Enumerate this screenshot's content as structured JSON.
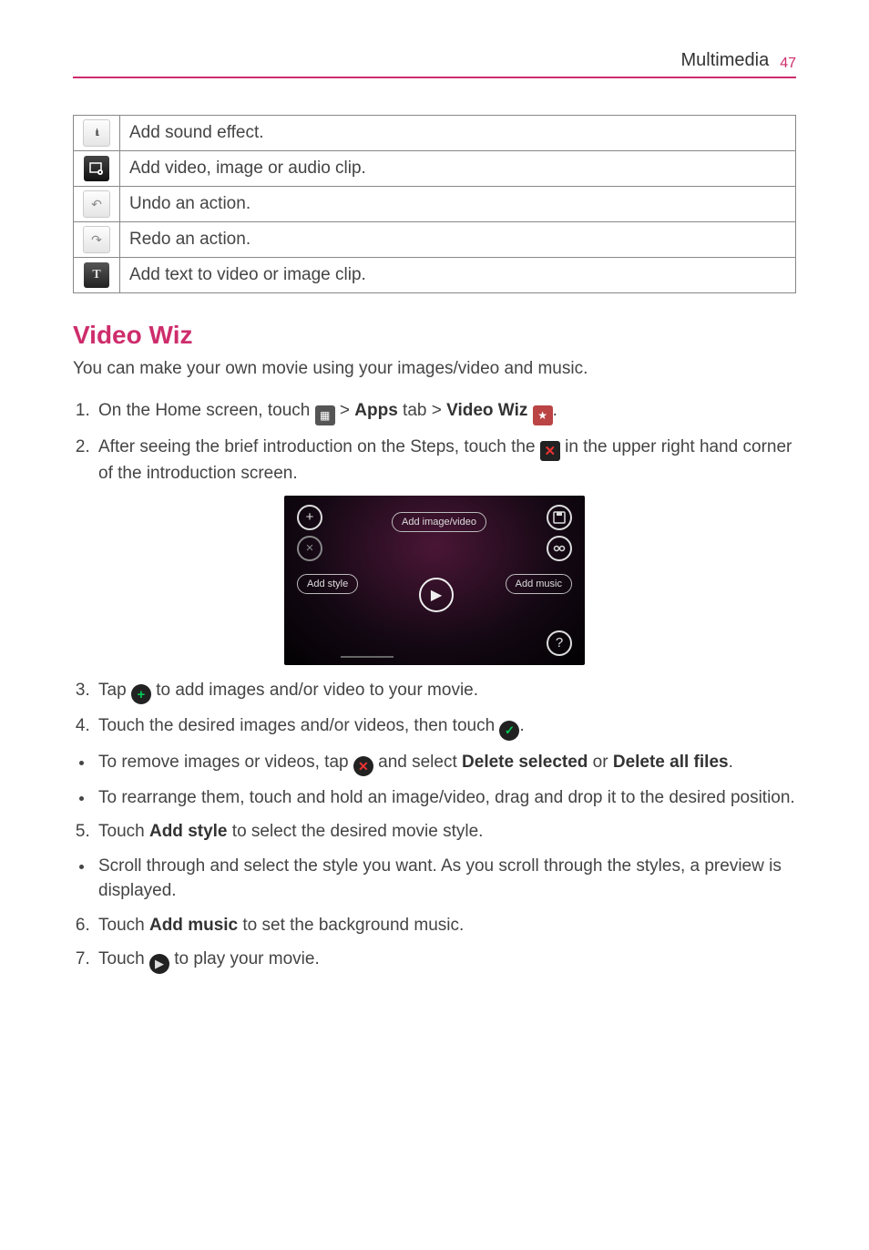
{
  "header": {
    "section": "Multimedia",
    "page": "47"
  },
  "table": {
    "rows": [
      {
        "icon": "sound-effect-icon",
        "text": "Add sound effect."
      },
      {
        "icon": "add-clip-icon",
        "text": "Add video, image or audio clip."
      },
      {
        "icon": "undo-icon",
        "text": "Undo an action."
      },
      {
        "icon": "redo-icon",
        "text": "Redo an action."
      },
      {
        "icon": "add-text-icon",
        "text": "Add text to video or image clip."
      }
    ]
  },
  "heading": "Video Wiz",
  "intro": "You can make your own movie using your images/video and music.",
  "step1": {
    "a": "On the Home screen, touch ",
    "b": " > ",
    "apps": "Apps",
    "c": " tab > ",
    "wiz": "Video Wiz",
    "d": " ",
    "e": "."
  },
  "step2": {
    "a": "After seeing the brief introduction on the Steps, touch the ",
    "b": " in the upper right hand corner of the introduction screen."
  },
  "screenshot": {
    "top": "Add image/video",
    "left": "Add style",
    "right": "Add music"
  },
  "step3": {
    "a": "Tap ",
    "b": " to add images and/or video to your movie."
  },
  "step4": {
    "a": "Touch the desired images and/or videos, then touch ",
    "b": "."
  },
  "bullet4a": {
    "a": "To remove images or videos, tap ",
    "b": " and select ",
    "ds": "Delete selected",
    "c": " or ",
    "da": "Delete all files",
    "d": "."
  },
  "bullet4b": "To rearrange them, touch and hold an image/video, drag and drop it to the desired position.",
  "step5": {
    "a": "Touch ",
    "as": "Add style",
    "b": " to select the desired movie style."
  },
  "bullet5a": "Scroll through and select the style you want. As you scroll through the styles, a preview is displayed.",
  "step6": {
    "a": "Touch ",
    "am": "Add music",
    "b": " to set the background music."
  },
  "step7": {
    "a": "Touch ",
    "b": " to play your movie."
  }
}
